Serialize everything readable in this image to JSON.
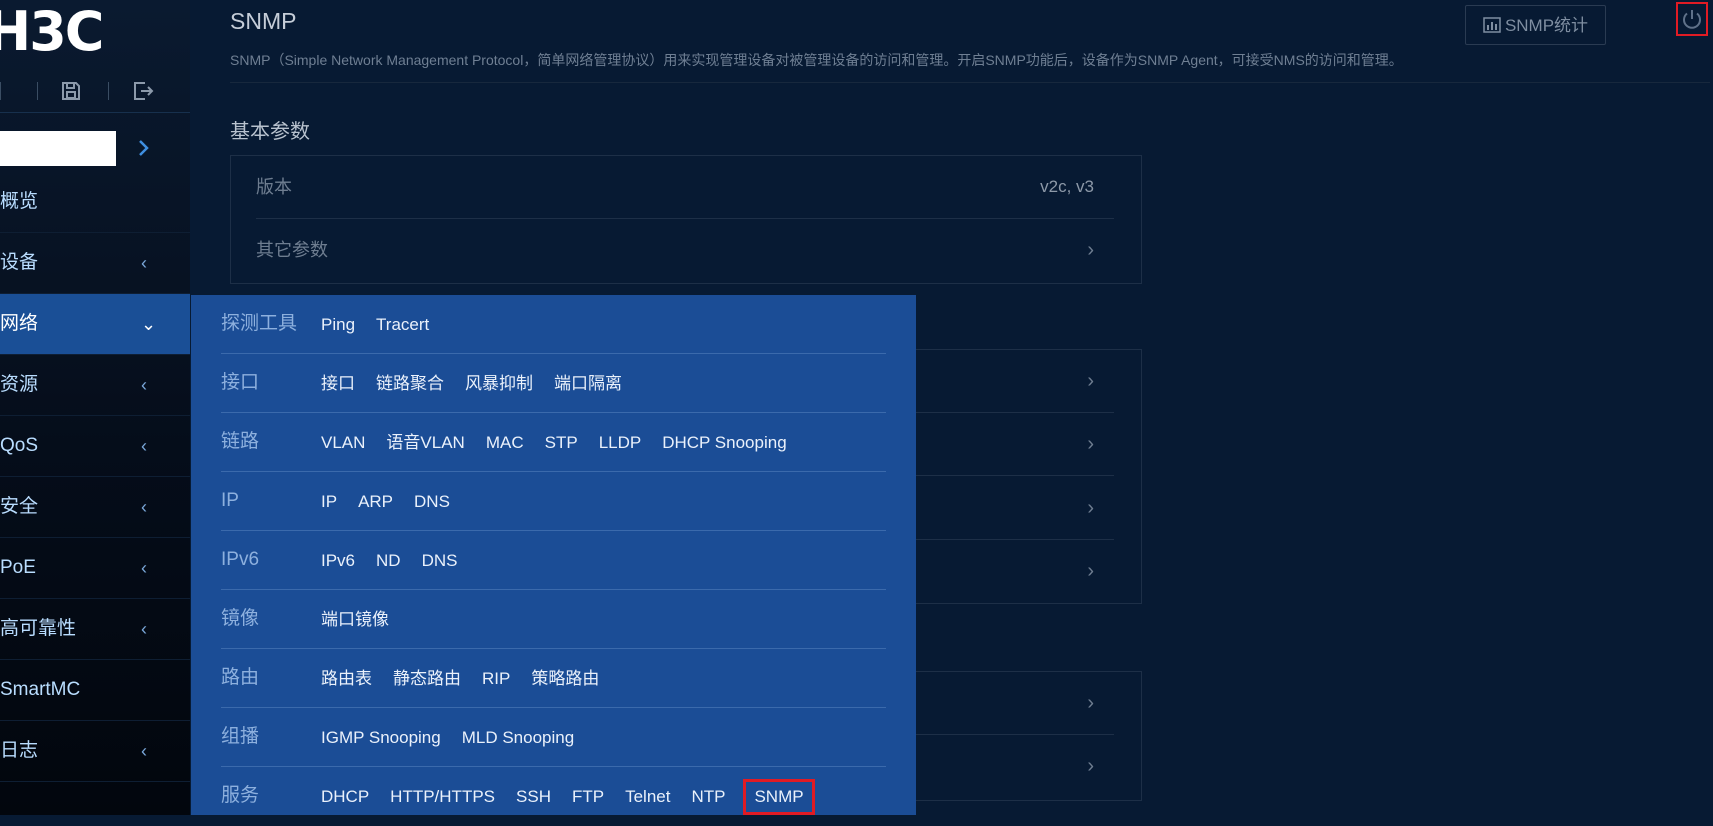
{
  "app": {
    "logo_text": "H3C"
  },
  "sidebar": {
    "search_value": "",
    "items": [
      {
        "label": "概览",
        "arrow": ""
      },
      {
        "label": "设备",
        "arrow": "‹"
      },
      {
        "label": "网络",
        "arrow": "⌄"
      },
      {
        "label": "资源",
        "arrow": "‹"
      },
      {
        "label": "QoS",
        "arrow": "‹"
      },
      {
        "label": "安全",
        "arrow": "‹"
      },
      {
        "label": "PoE",
        "arrow": "‹"
      },
      {
        "label": "高可靠性",
        "arrow": "‹"
      },
      {
        "label": "SmartMC",
        "arrow": ""
      },
      {
        "label": "日志",
        "arrow": "‹"
      }
    ]
  },
  "page": {
    "title": "SNMP",
    "description": "SNMP（Simple Network Management Protocol，简单网络管理协议）用来实现管理设备对被管理设备的访问和管理。开启SNMP功能后，设备作为SNMP Agent，可接受NMS的访问和管理。",
    "stats_button": "SNMP统计",
    "basic_section": "基本参数",
    "version_label": "版本",
    "version_value": "v2c, v3",
    "other_params_label": "其它参数"
  },
  "flyout": {
    "rows": [
      {
        "title": "探测工具",
        "items": [
          "Ping",
          "Tracert"
        ]
      },
      {
        "title": "接口",
        "items": [
          "接口",
          "链路聚合",
          "风暴抑制",
          "端口隔离"
        ]
      },
      {
        "title": "链路",
        "items": [
          "VLAN",
          "语音VLAN",
          "MAC",
          "STP",
          "LLDP",
          "DHCP Snooping"
        ]
      },
      {
        "title": "IP",
        "items": [
          "IP",
          "ARP",
          "DNS"
        ]
      },
      {
        "title": "IPv6",
        "items": [
          "IPv6",
          "ND",
          "DNS"
        ]
      },
      {
        "title": "镜像",
        "items": [
          "端口镜像"
        ]
      },
      {
        "title": "路由",
        "items": [
          "路由表",
          "静态路由",
          "RIP",
          "策略路由"
        ]
      },
      {
        "title": "组播",
        "items": [
          "IGMP Snooping",
          "MLD Snooping"
        ]
      },
      {
        "title": "服务",
        "items": [
          "DHCP",
          "HTTP/HTTPS",
          "SSH",
          "FTP",
          "Telnet",
          "NTP",
          "SNMP"
        ]
      }
    ],
    "highlighted": "SNMP"
  },
  "colors": {
    "accent": "#1b4d96",
    "highlight": "#e01b24",
    "background": "#071a33"
  },
  "icons": [
    "save-icon",
    "logout-icon",
    "chevron-right-icon",
    "power-icon",
    "bar-chart-icon",
    "collapse-arrow-icon"
  ]
}
